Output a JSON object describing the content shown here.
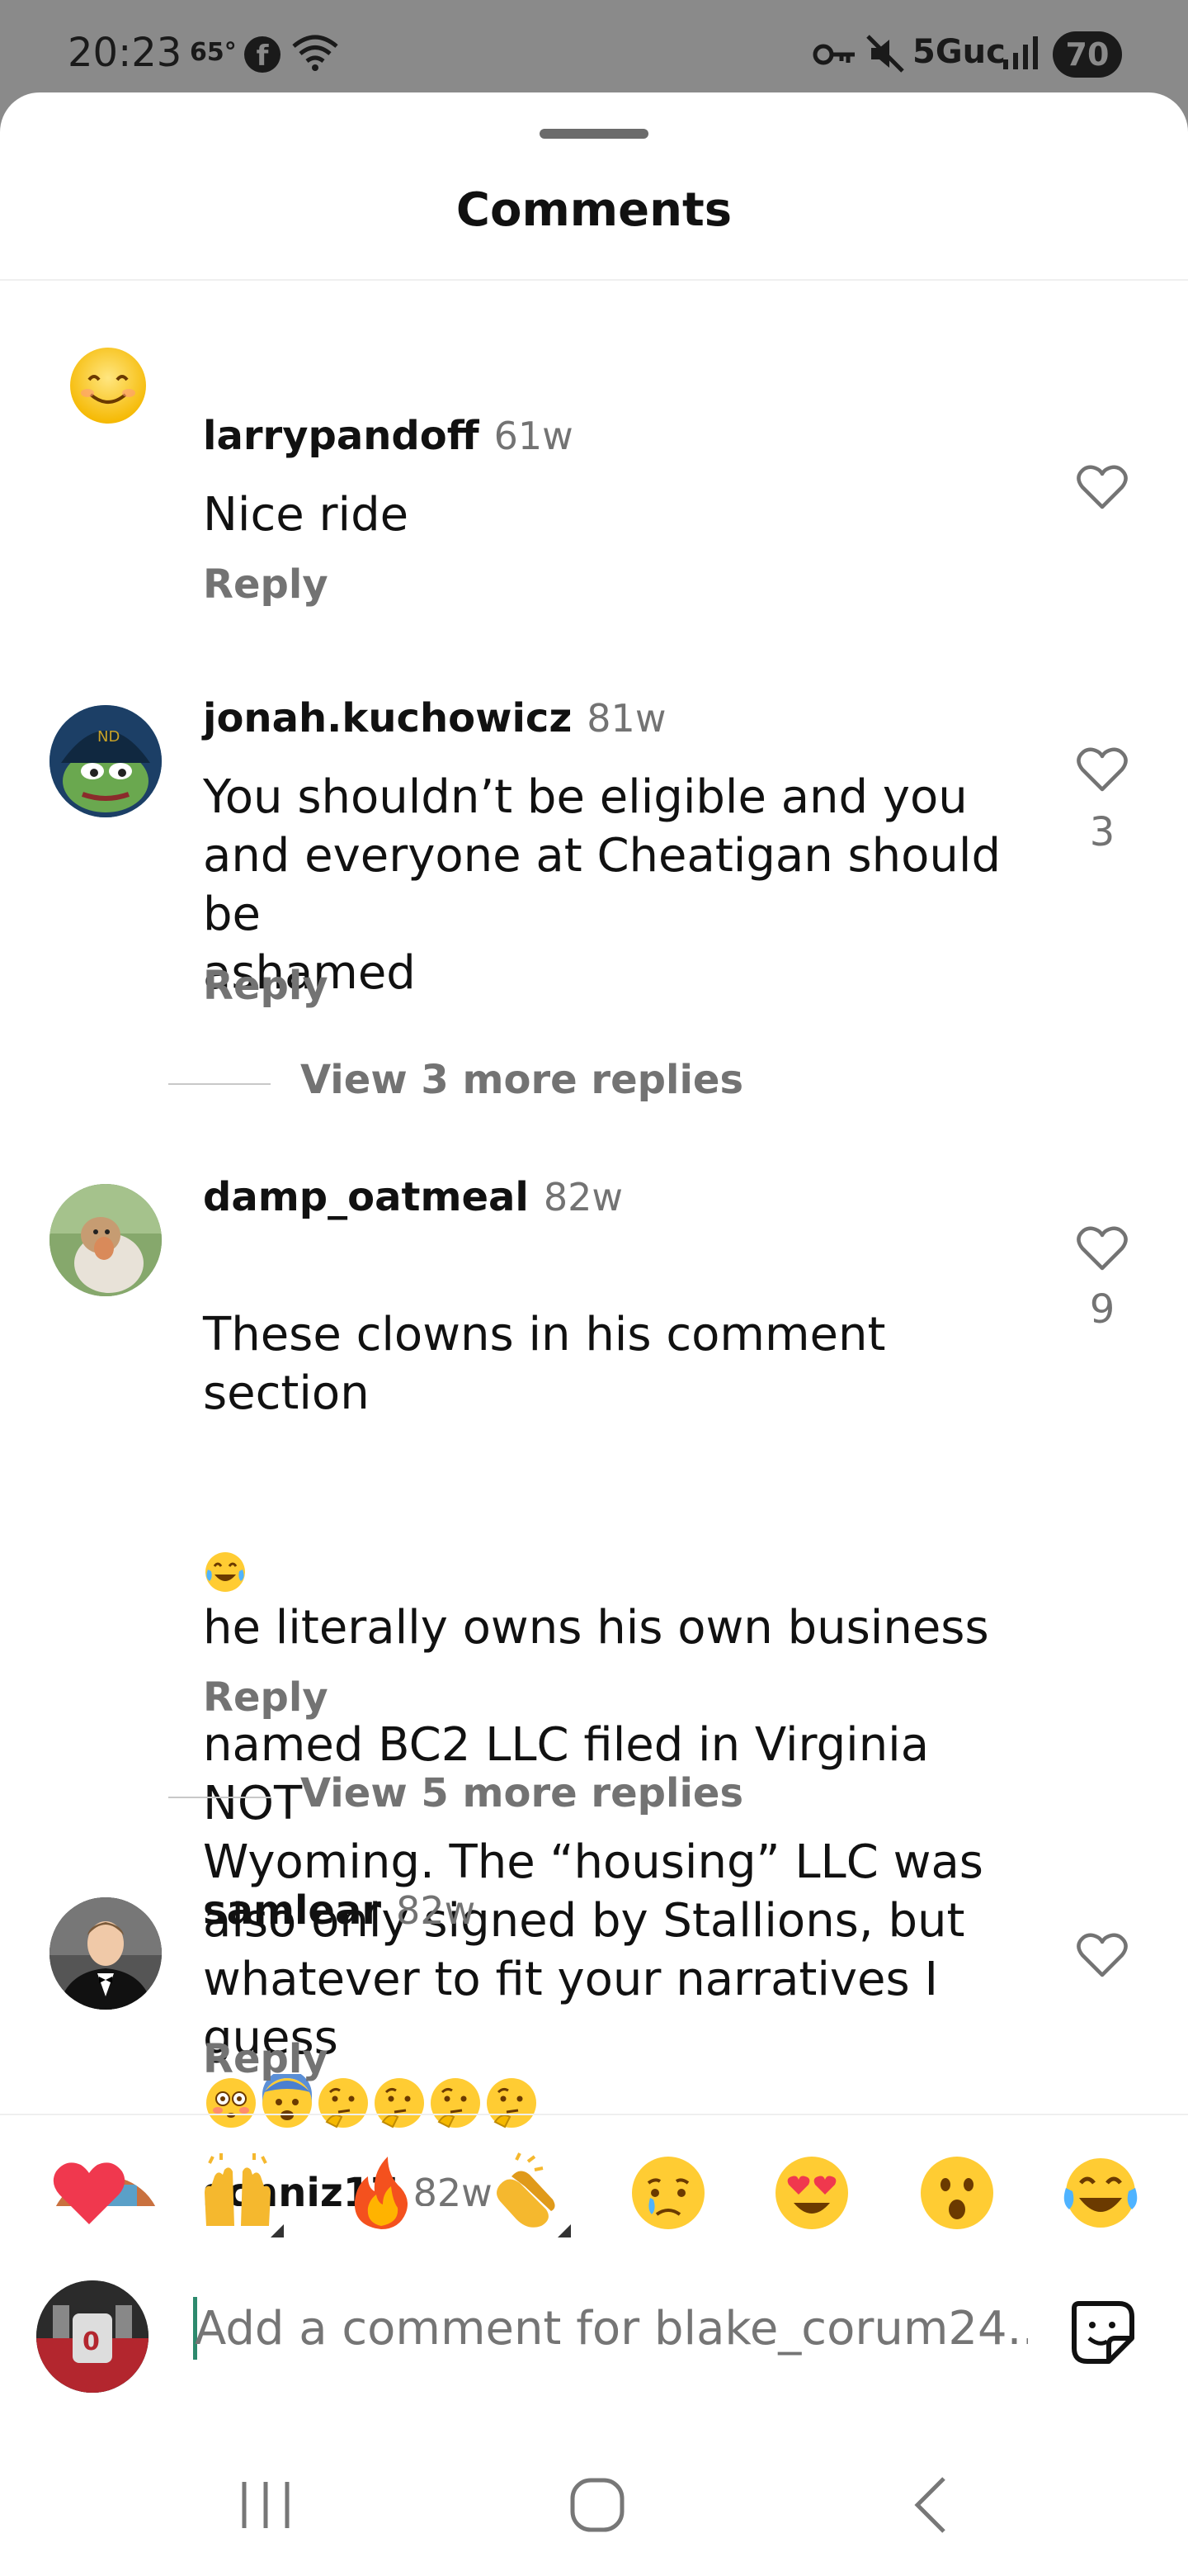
{
  "status_bar": {
    "time": "20:23",
    "temperature": "65°",
    "facebook_icon": "f",
    "network": "5Guc",
    "battery": "70"
  },
  "sheet": {
    "title": "Comments"
  },
  "comments": [
    {
      "username": "larrypandoff",
      "age": "61w",
      "text": "Nice ride",
      "reply_label": "Reply",
      "likes": "",
      "avatar": "smiley-emoji-avatar"
    },
    {
      "username": "jonah.kuchowicz",
      "age": "81w",
      "text": "You shouldn’t be eligible and you\nand everyone at Cheatigan should be\nashamed",
      "reply_label": "Reply",
      "likes": "3",
      "view_more": "View 3 more replies",
      "avatar": "frog-helmet-avatar"
    },
    {
      "username": "damp_oatmeal",
      "age": "82w",
      "text_first_line_emoji": "he literally owns his own business",
      "text_prefix": "These clowns in his comment section",
      "text_rest": "named BC2 LLC filed in Virginia NOT\nWyoming. The “housing” LLC was\nalso only signed by Stallions, but\nwhatever to fit your narratives I\nguess",
      "reply_label": "Reply",
      "likes": "9",
      "view_more": "View 5 more replies",
      "avatar": "monkey-photo-avatar"
    },
    {
      "username": "samlear",
      "age": "82w",
      "text": "😳😨🤔🤔🤔🤔",
      "reply_label": "Reply",
      "likes": "",
      "avatar": "man-tuxedo-avatar"
    },
    {
      "username": "schniz17",
      "age": "82w",
      "avatar": "partial-avatar"
    }
  ],
  "reactions": [
    "red-heart",
    "raising-hands",
    "fire",
    "clapping-hands",
    "crying-face",
    "heart-eyes",
    "surprised-face",
    "tears-of-joy"
  ],
  "composer": {
    "placeholder": "Add a comment for blake_corum24..."
  },
  "navigation": [
    "recent-apps",
    "home",
    "back"
  ]
}
